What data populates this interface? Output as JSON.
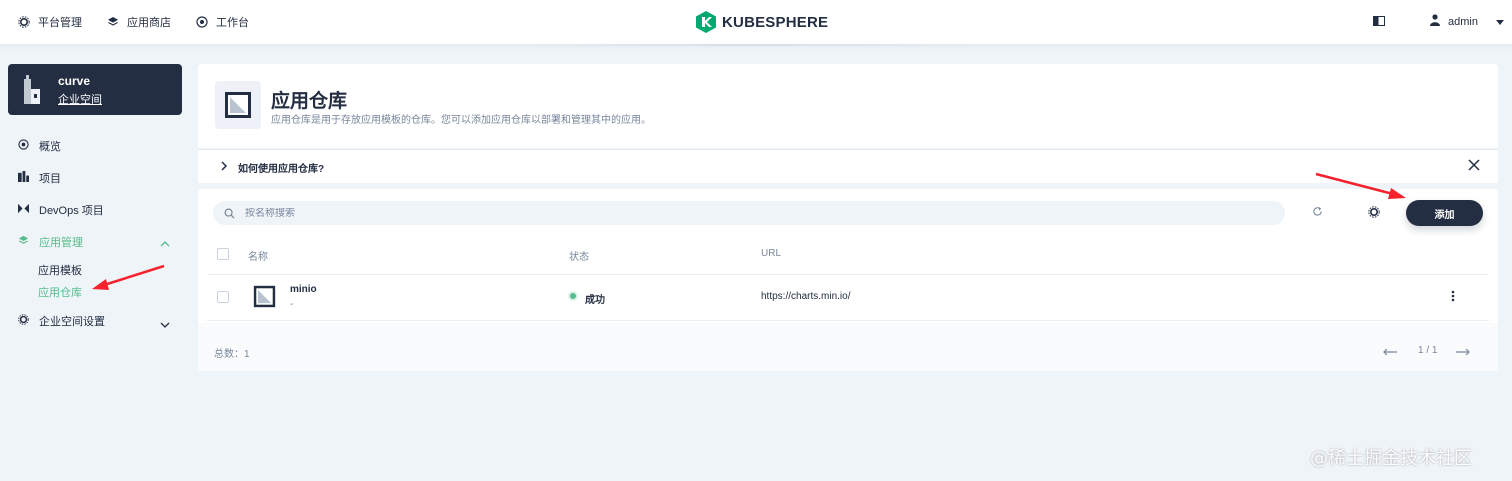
{
  "topnav": {
    "platform_label": "平台管理",
    "appstore_label": "应用商店",
    "workbench_label": "工作台",
    "logo_text": "KUBESPHERE",
    "user_name": "admin"
  },
  "workspace": {
    "name": "curve",
    "type": "企业空间"
  },
  "sidebar": {
    "items": [
      {
        "label": "概览",
        "icon": "dashboard-icon"
      },
      {
        "label": "项目",
        "icon": "project-icon"
      },
      {
        "label": "DevOps 项目",
        "icon": "devops-icon"
      },
      {
        "label": "应用管理",
        "icon": "apps-icon"
      },
      {
        "label": "企业空间设置",
        "icon": "gear-icon"
      }
    ],
    "app_sub": [
      "应用模板",
      "应用仓库"
    ]
  },
  "page": {
    "title": "应用仓库",
    "description": "应用仓库是用于存放应用模板的仓库。您可以添加应用仓库以部署和管理其中的应用。",
    "help_text": "如何使用应用仓库?"
  },
  "toolbar": {
    "search_placeholder": "按名称搜索",
    "add_label": "添加"
  },
  "table": {
    "columns": [
      "名称",
      "状态",
      "URL"
    ],
    "rows": [
      {
        "name": "minio",
        "desc": "-",
        "status": "成功",
        "url": "https://charts.min.io/"
      }
    ]
  },
  "footer": {
    "total": "总数：1",
    "page": "1 / 1"
  },
  "colors": {
    "accent": "#55bc8a",
    "dark": "#242e42",
    "annotation_arrow": "#f5222d"
  },
  "watermark": "@稀土掘金技术社区"
}
